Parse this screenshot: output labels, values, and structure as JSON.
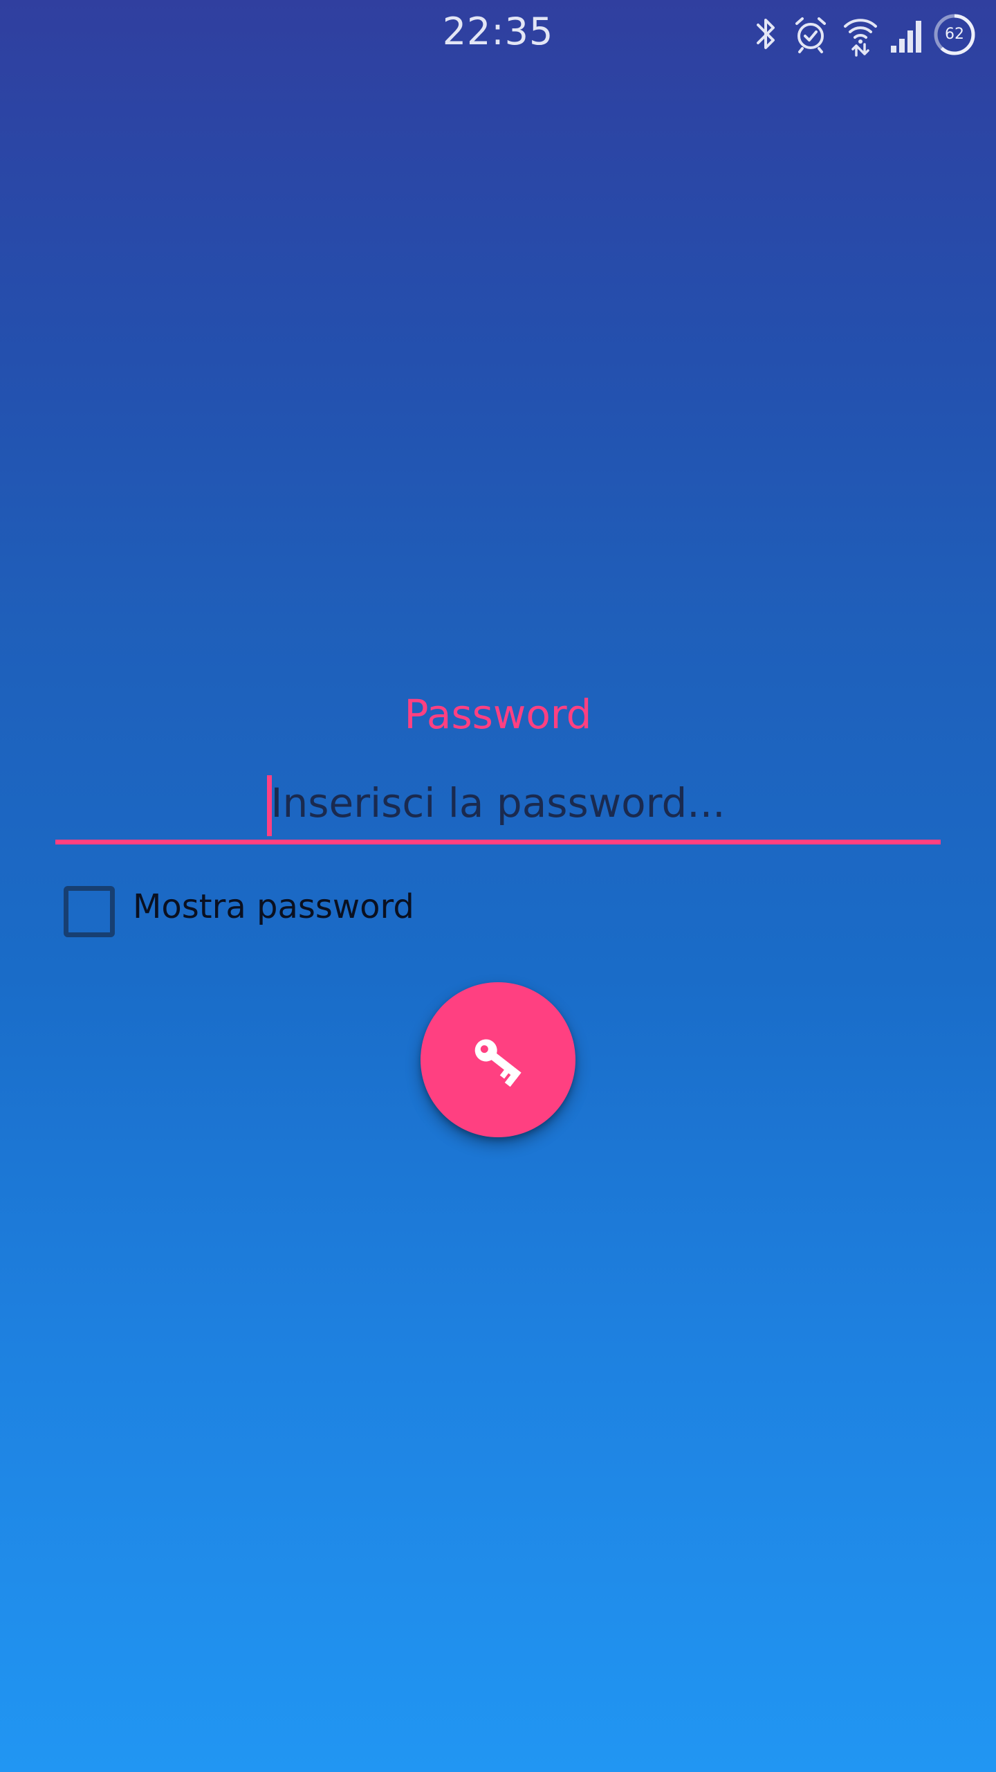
{
  "status_bar": {
    "time": "22:35",
    "battery_level": "62",
    "icons": [
      "bluetooth-icon",
      "alarm-icon",
      "wifi-icon",
      "cell-signal-icon",
      "battery-ring-icon"
    ]
  },
  "form": {
    "label": "Password",
    "placeholder": "Inserisci la password...",
    "show_password_label": "Mostra password",
    "show_password_checked": false,
    "submit_icon": "key-icon"
  },
  "colors": {
    "accent": "#ff4081",
    "gradient_top": "#303f9f",
    "gradient_bottom": "#2196f3",
    "checkbox_border": "#173f72",
    "input_text": "#1a2a4f"
  }
}
